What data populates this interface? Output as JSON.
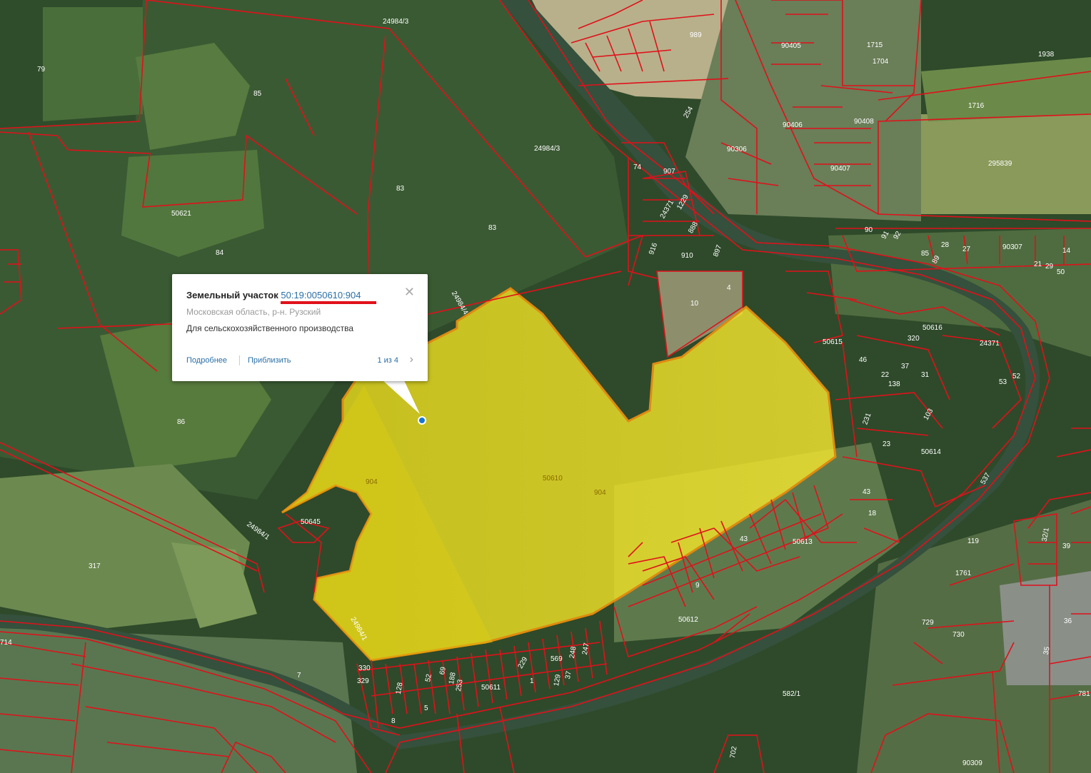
{
  "popup": {
    "type_label": "Земельный участок",
    "cadastral_number": "50:19:0050610:904",
    "address": "Московская область, р-н. Рузский",
    "purpose": "Для сельскохозяйственного производства",
    "close_icon": "close-icon",
    "details_link": "Подробнее",
    "zoom_link": "Приблизить",
    "pager": "1 из 4",
    "next_icon": "chevron-right-icon"
  },
  "colors": {
    "parcel_border": "#e0111b",
    "selected_fill": "#f4e41e",
    "link": "#2a6fa6"
  },
  "map_labels": {
    "l79": "79",
    "l85": "85",
    "l24984_3a": "24984/3",
    "l24984_3b": "24984/3",
    "l83a": "83",
    "l83b": "83",
    "l50621": "50621",
    "l84": "84",
    "l86": "86",
    "l317": "317",
    "l7": "7",
    "l989": "989",
    "l90405": "90405",
    "l1715": "1715",
    "l1704": "1704",
    "l1938": "1938",
    "l1716": "1716",
    "l295839": "295839",
    "l90406": "90406",
    "l90408": "90408",
    "l90306": "90306",
    "l90407": "90407",
    "l254": "254",
    "l74": "74",
    "l907": "907",
    "l24371a": "24371",
    "l1229": "1229",
    "l888": "888",
    "l910": "910",
    "l897": "897",
    "l916": "916",
    "l10": "10",
    "l4": "4",
    "l90": "90",
    "l91": "91",
    "l92": "92",
    "l28": "28",
    "l27": "27",
    "l90307": "90307",
    "l14": "14",
    "l85b": "85",
    "l89": "89",
    "l21": "21",
    "l29": "29",
    "l50": "50",
    "l50616": "50616",
    "l320": "320",
    "l50615": "50615",
    "l24371b": "24371",
    "l46": "46",
    "l22": "22",
    "l138": "138",
    "l37": "37",
    "l31": "31",
    "l53": "53",
    "l52": "52",
    "l231": "231",
    "l23": "23",
    "l103": "103",
    "l50614": "50614",
    "l537": "537",
    "l43a": "43",
    "l18": "18",
    "l119": "119",
    "l32_1": "32/1",
    "l39": "39",
    "l1761": "1761",
    "l729": "729",
    "l730": "730",
    "l36": "36",
    "l35": "35",
    "l781": "781",
    "l582_1": "582/1",
    "l90309": "90309",
    "l702": "702",
    "l50613": "50613",
    "l43b": "43",
    "l50612": "50612",
    "l9": "9",
    "l50611": "50611",
    "l330": "330",
    "l329": "329",
    "l128": "128",
    "l52b": "52",
    "l69": "69",
    "l188": "188",
    "l253": "253",
    "l5": "5",
    "l8": "8",
    "l229": "229",
    "l569": "569",
    "l248": "248",
    "l247": "247",
    "l37b": "37",
    "l129": "129",
    "l1": "1",
    "l24984_1a": "24984/1",
    "l24984_1b": "24984/1",
    "l24984_4": "24984/4",
    "l50645": "50645",
    "l714": "714",
    "l904a": "904",
    "l904b": "904",
    "l50610": "50610"
  }
}
